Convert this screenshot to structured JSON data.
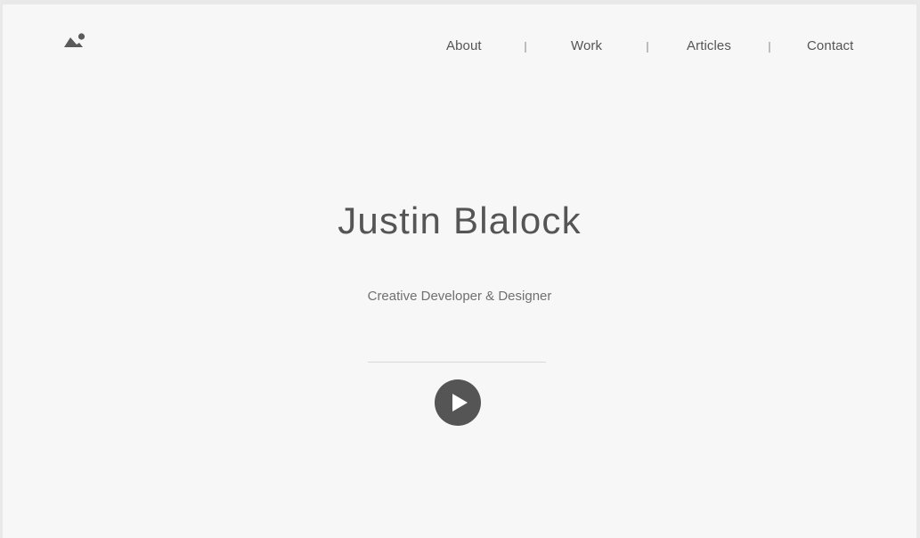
{
  "header": {
    "logo_icon": "mountain-sun-icon",
    "nav": [
      {
        "label": "About"
      },
      {
        "label": "Work"
      },
      {
        "label": "Articles"
      },
      {
        "label": "Contact"
      }
    ]
  },
  "hero": {
    "title": "Justin Blalock",
    "subtitle": "Creative Developer & Designer",
    "play_icon": "play-icon"
  },
  "colors": {
    "page_background": "#f7f7f7",
    "frame_background": "#e9e9e9",
    "text_dark": "#555555",
    "text_muted": "#707070",
    "separator": "#bdbdbd"
  }
}
